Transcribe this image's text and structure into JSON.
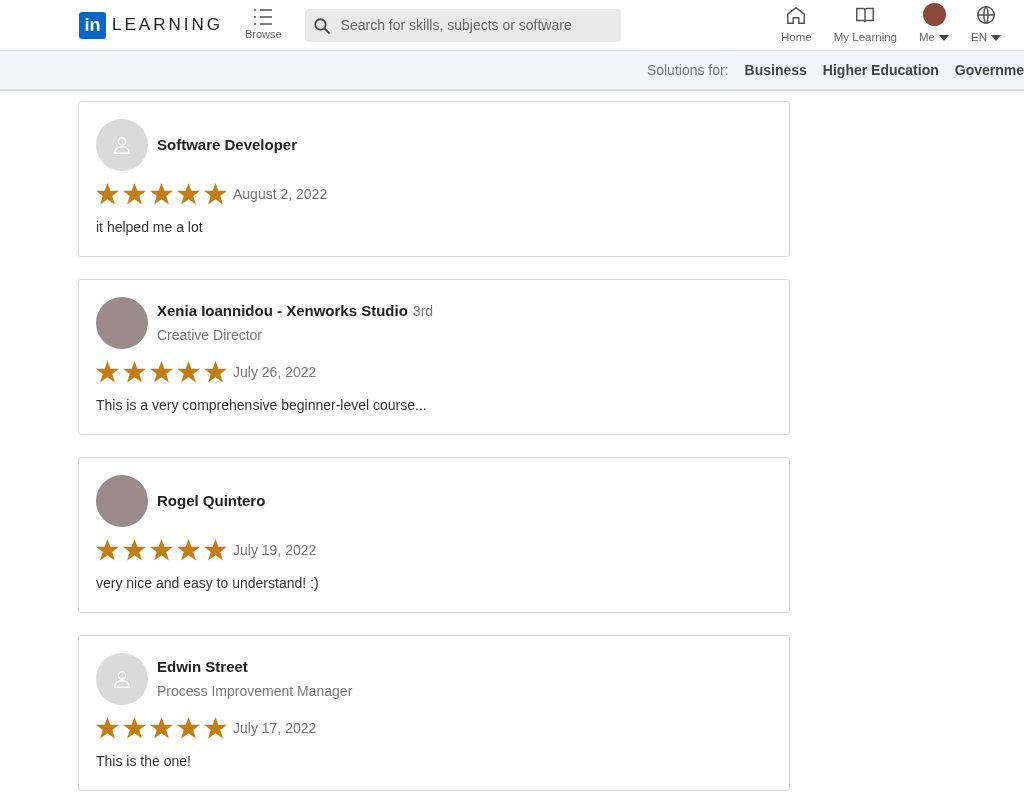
{
  "header": {
    "logo": {
      "badge": "in",
      "text": "LEARNING"
    },
    "browse": "Browse",
    "search": {
      "placeholder": "Search for skills, subjects or software"
    },
    "nav": [
      {
        "kind": "home",
        "label": "Home",
        "dropdown": false
      },
      {
        "kind": "book",
        "label": "My Learning",
        "dropdown": false
      },
      {
        "kind": "avatar",
        "label": "Me",
        "dropdown": true
      },
      {
        "kind": "globe",
        "label": "EN",
        "dropdown": true
      }
    ]
  },
  "solutions_bar": {
    "label": "Solutions for:",
    "links": [
      "Business",
      "Higher Education",
      "Governme"
    ]
  },
  "reviews": [
    {
      "avatar": {
        "kind": "placeholder"
      },
      "name": "Software Developer",
      "stars": 5,
      "date": "August 2, 2022",
      "text": "it helped me a lot"
    },
    {
      "avatar": {
        "kind": "photo"
      },
      "name": "Xenia Ioannidou - Xenworks Studio",
      "degree": "3rd",
      "headline": "Creative Director",
      "stars": 5,
      "date": "July 26, 2022",
      "text": "This is a very comprehensive beginner-level course..."
    },
    {
      "avatar": {
        "kind": "photo"
      },
      "name": "Rogel Quintero",
      "stars": 5,
      "date": "July 19, 2022",
      "text": "very nice and easy to understand! :)"
    },
    {
      "avatar": {
        "kind": "placeholder"
      },
      "name": "Edwin Street",
      "headline": "Process Improvement Manager",
      "stars": 5,
      "date": "July 17, 2022",
      "text": "This is the one!"
    }
  ]
}
